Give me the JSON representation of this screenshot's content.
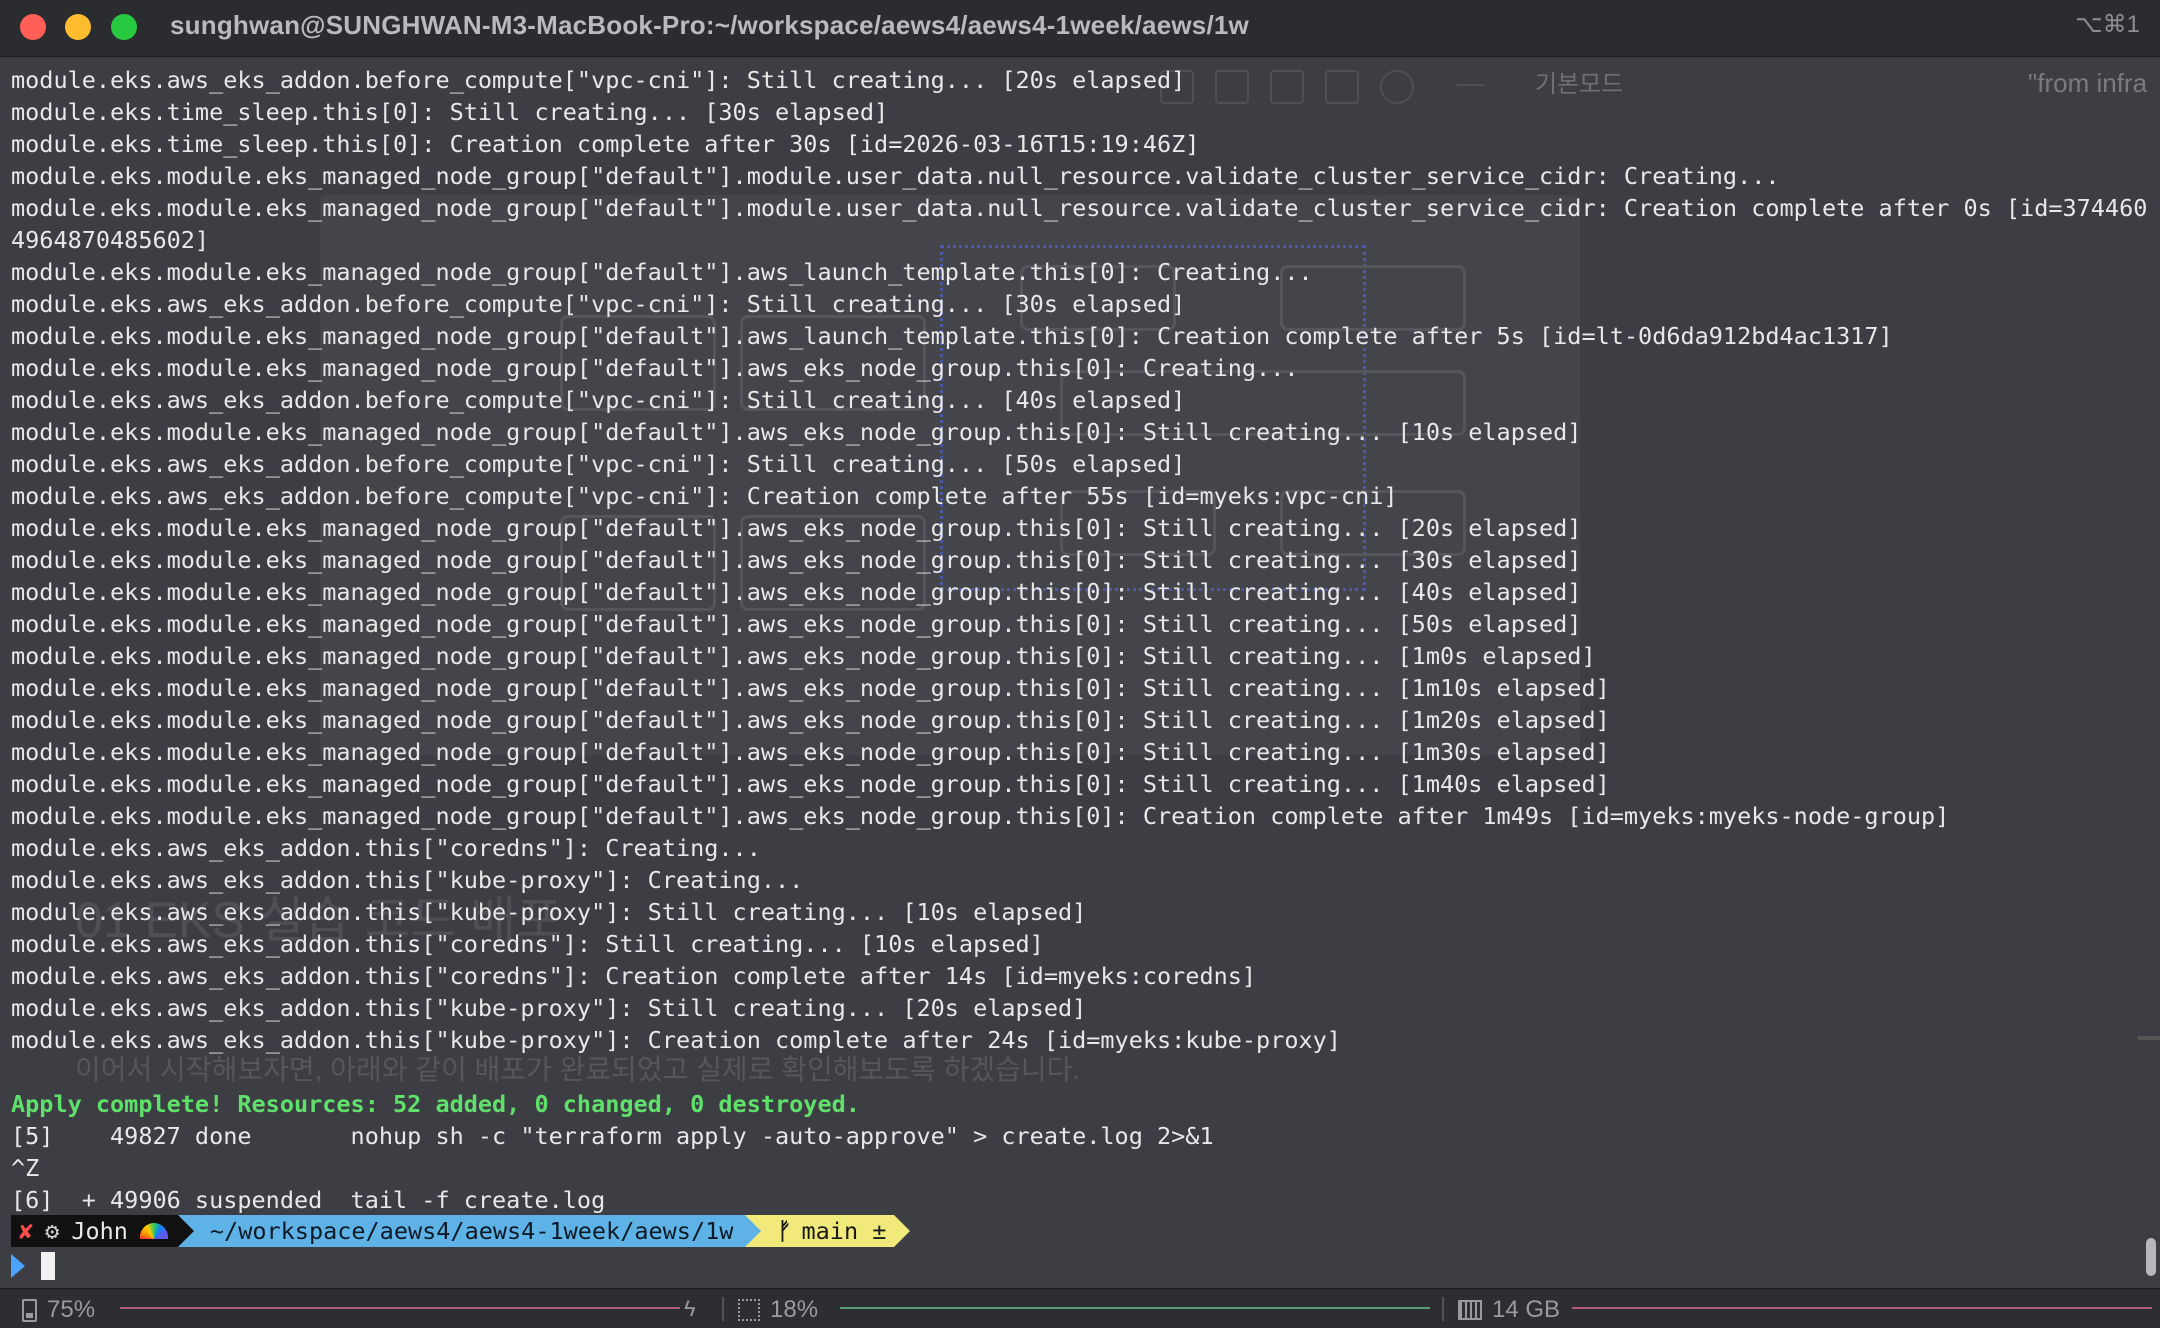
{
  "window": {
    "title": "sunghwan@SUNGHWAN-M3-MacBook-Pro:~/workspace/aews4/aews4-1week/aews/1w",
    "shortcut": "⌥⌘1"
  },
  "background_doc": {
    "mode_label": "기본모드",
    "from_text": "\"from infra",
    "heading": "01 EKS 실습 코드 배포",
    "paragraph_1": "이어서 시작해보자면, 아래와 같이 배포가 완료되었고 실제로 확인해보도록 하겠습니다."
  },
  "terminal": {
    "lines": [
      "module.eks.aws_eks_addon.before_compute[\"vpc-cni\"]: Still creating... [20s elapsed]",
      "module.eks.time_sleep.this[0]: Still creating... [30s elapsed]",
      "module.eks.time_sleep.this[0]: Creation complete after 30s [id=2026-03-16T15:19:46Z]",
      "module.eks.module.eks_managed_node_group[\"default\"].module.user_data.null_resource.validate_cluster_service_cidr: Creating...",
      "module.eks.module.eks_managed_node_group[\"default\"].module.user_data.null_resource.validate_cluster_service_cidr: Creation complete after 0s [id=374460",
      "4964870485602]",
      "module.eks.module.eks_managed_node_group[\"default\"].aws_launch_template.this[0]: Creating...",
      "module.eks.aws_eks_addon.before_compute[\"vpc-cni\"]: Still creating... [30s elapsed]",
      "module.eks.module.eks_managed_node_group[\"default\"].aws_launch_template.this[0]: Creation complete after 5s [id=lt-0d6da912bd4ac1317]",
      "module.eks.module.eks_managed_node_group[\"default\"].aws_eks_node_group.this[0]: Creating...",
      "module.eks.aws_eks_addon.before_compute[\"vpc-cni\"]: Still creating... [40s elapsed]",
      "module.eks.module.eks_managed_node_group[\"default\"].aws_eks_node_group.this[0]: Still creating... [10s elapsed]",
      "module.eks.aws_eks_addon.before_compute[\"vpc-cni\"]: Still creating... [50s elapsed]",
      "module.eks.aws_eks_addon.before_compute[\"vpc-cni\"]: Creation complete after 55s [id=myeks:vpc-cni]",
      "module.eks.module.eks_managed_node_group[\"default\"].aws_eks_node_group.this[0]: Still creating... [20s elapsed]",
      "module.eks.module.eks_managed_node_group[\"default\"].aws_eks_node_group.this[0]: Still creating... [30s elapsed]",
      "module.eks.module.eks_managed_node_group[\"default\"].aws_eks_node_group.this[0]: Still creating... [40s elapsed]",
      "module.eks.module.eks_managed_node_group[\"default\"].aws_eks_node_group.this[0]: Still creating... [50s elapsed]",
      "module.eks.module.eks_managed_node_group[\"default\"].aws_eks_node_group.this[0]: Still creating... [1m0s elapsed]",
      "module.eks.module.eks_managed_node_group[\"default\"].aws_eks_node_group.this[0]: Still creating... [1m10s elapsed]",
      "module.eks.module.eks_managed_node_group[\"default\"].aws_eks_node_group.this[0]: Still creating... [1m20s elapsed]",
      "module.eks.module.eks_managed_node_group[\"default\"].aws_eks_node_group.this[0]: Still creating... [1m30s elapsed]",
      "module.eks.module.eks_managed_node_group[\"default\"].aws_eks_node_group.this[0]: Still creating... [1m40s elapsed]",
      "module.eks.module.eks_managed_node_group[\"default\"].aws_eks_node_group.this[0]: Creation complete after 1m49s [id=myeks:myeks-node-group]",
      "module.eks.aws_eks_addon.this[\"coredns\"]: Creating...",
      "module.eks.aws_eks_addon.this[\"kube-proxy\"]: Creating...",
      "module.eks.aws_eks_addon.this[\"kube-proxy\"]: Still creating... [10s elapsed]",
      "module.eks.aws_eks_addon.this[\"coredns\"]: Still creating... [10s elapsed]",
      "module.eks.aws_eks_addon.this[\"coredns\"]: Creation complete after 14s [id=myeks:coredns]",
      "module.eks.aws_eks_addon.this[\"kube-proxy\"]: Still creating... [20s elapsed]",
      "module.eks.aws_eks_addon.this[\"kube-proxy\"]: Creation complete after 24s [id=myeks:kube-proxy]",
      "",
      "Apply complete! Resources: 52 added, 0 changed, 0 destroyed.",
      "[5]    49827 done       nohup sh -c \"terraform apply -auto-approve\" > create.log 2>&1",
      "^Z",
      "[6]  + 49906 suspended  tail -f create.log"
    ],
    "success_line_index": 32
  },
  "prompt": {
    "status": "✘",
    "gear": "⚙",
    "user": "John",
    "path": "~/workspace/aews4/aews4-1week/aews/1w",
    "branch_icon": "ᚠ",
    "branch": "main ±"
  },
  "statusbar": {
    "battery": "75%",
    "cpu": "18%",
    "memory": "14 GB"
  },
  "colors": {
    "terminal_bg": "#3d3e43",
    "text": "#e8e8e8",
    "success": "#5ee06a",
    "path_segment": "#5fb2e6",
    "git_segment": "#f1ea7a",
    "cursor_arrow": "#4aa3ff"
  },
  "icons": [
    "close-button",
    "minimize-button",
    "maximize-button",
    "battery-icon",
    "bolt-icon",
    "cpu-icon",
    "memory-icon",
    "rainbow-icon",
    "branch-icon"
  ]
}
